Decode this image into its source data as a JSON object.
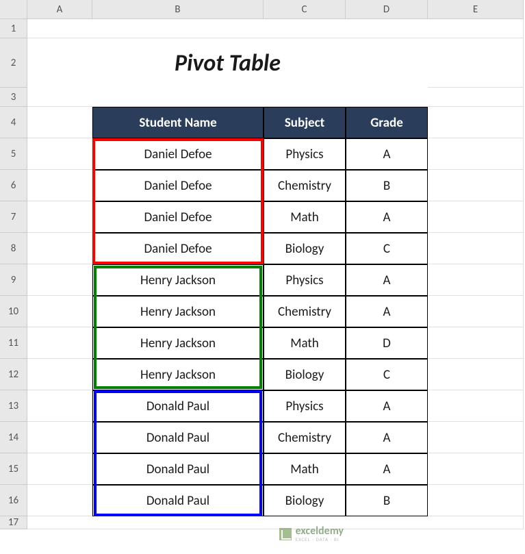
{
  "columns": [
    "A",
    "B",
    "C",
    "D",
    "E"
  ],
  "rows": [
    "1",
    "2",
    "3",
    "4",
    "5",
    "6",
    "7",
    "8",
    "9",
    "10",
    "11",
    "12",
    "13",
    "14",
    "15",
    "16",
    "17"
  ],
  "title": "Pivot Table",
  "headers": {
    "student_name": "Student Name",
    "subject": "Subject",
    "grade": "Grade"
  },
  "data": [
    {
      "name": "Daniel Defoe",
      "subject": "Physics",
      "grade": "A"
    },
    {
      "name": "Daniel Defoe",
      "subject": "Chemistry",
      "grade": "B"
    },
    {
      "name": "Daniel Defoe",
      "subject": "Math",
      "grade": "A"
    },
    {
      "name": "Daniel Defoe",
      "subject": "Biology",
      "grade": "C"
    },
    {
      "name": "Henry Jackson",
      "subject": "Physics",
      "grade": "A"
    },
    {
      "name": "Henry Jackson",
      "subject": "Chemistry",
      "grade": "A"
    },
    {
      "name": "Henry Jackson",
      "subject": "Math",
      "grade": "D"
    },
    {
      "name": "Henry Jackson",
      "subject": "Biology",
      "grade": "C"
    },
    {
      "name": "Donald Paul",
      "subject": "Physics",
      "grade": "A"
    },
    {
      "name": "Donald Paul",
      "subject": "Chemistry",
      "grade": "A"
    },
    {
      "name": "Donald Paul",
      "subject": "Math",
      "grade": "A"
    },
    {
      "name": "Donald Paul",
      "subject": "Biology",
      "grade": "B"
    }
  ],
  "watermark": {
    "main": "exceldemy",
    "sub": "EXCEL · DATA · BI"
  },
  "highlight_colors": {
    "red": "#ff0000",
    "green": "#008000",
    "blue": "#0000ff"
  }
}
